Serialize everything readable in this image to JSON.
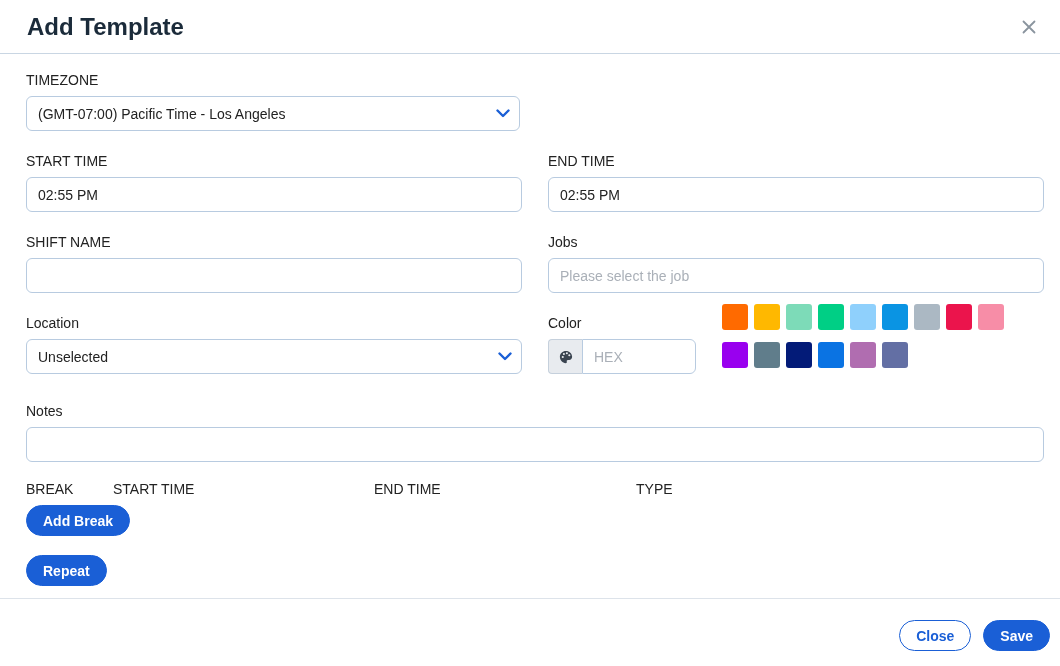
{
  "dialog": {
    "title": "Add Template"
  },
  "timezone": {
    "label": "TIMEZONE",
    "value": "(GMT-07:00) Pacific Time - Los Angeles"
  },
  "start_time": {
    "label": "START TIME",
    "value": "02:55 PM"
  },
  "end_time": {
    "label": "END TIME",
    "value": "02:55 PM"
  },
  "shift_name": {
    "label": "SHIFT NAME"
  },
  "jobs": {
    "label": "Jobs",
    "placeholder": "Please select the job"
  },
  "location": {
    "label": "Location",
    "value": "Unselected"
  },
  "color": {
    "label": "Color",
    "placeholder": "HEX",
    "swatches": [
      {
        "color": "#ff6a00",
        "selected": false
      },
      {
        "color": "#ffb800",
        "selected": false
      },
      {
        "color": "#7ddbb8",
        "selected": false
      },
      {
        "color": "#00cf85",
        "selected": false
      },
      {
        "color": "#8fd0fc",
        "selected": false
      },
      {
        "color": "#0a94e3",
        "selected": false
      },
      {
        "color": "#abb8c3",
        "selected": false
      },
      {
        "color": "#eb144c",
        "selected": false
      },
      {
        "color": "#f78da7",
        "selected": false
      },
      {
        "color": "#9900ef",
        "selected": false
      },
      {
        "color": "#607d8b",
        "selected": false
      },
      {
        "color": "#031b78",
        "selected": false
      },
      {
        "color": "#0a73e3",
        "selected": false
      },
      {
        "color": "#b06db0",
        "selected": false
      },
      {
        "color": "#636fa4",
        "selected": false
      }
    ]
  },
  "notes": {
    "label": "Notes"
  },
  "break_table": {
    "columns": [
      "BREAK",
      "START TIME",
      "END TIME",
      "TYPE"
    ]
  },
  "add_break_button": "Add Break",
  "repeat_button": "Repeat",
  "footer_buttons": [
    {
      "label": "Close",
      "kind": "secondary"
    },
    {
      "label": "Save",
      "kind": "primary"
    }
  ]
}
